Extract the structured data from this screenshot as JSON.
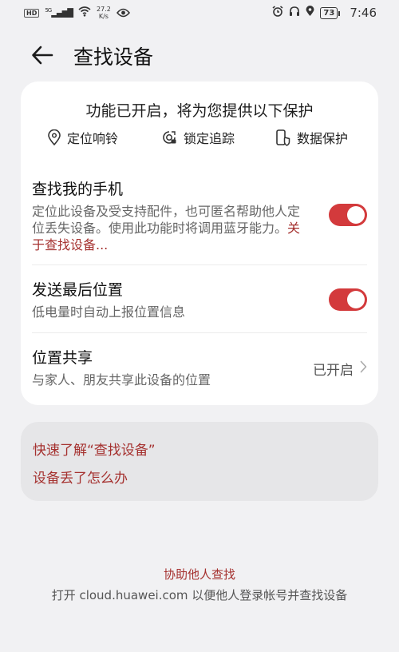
{
  "status_bar": {
    "network_badge": "HD",
    "signal": "5G",
    "speed_value": "27.2",
    "speed_unit": "K/s",
    "battery": "73",
    "time": "7:46",
    "icons": [
      "hd-icon",
      "signal-icon",
      "wifi-icon",
      "eye-icon",
      "alarm-icon",
      "headphones-icon",
      "location-icon",
      "battery-icon"
    ]
  },
  "header": {
    "back_icon": "arrow-left-icon",
    "title": "查找设备"
  },
  "banner": {
    "title": "功能已开启，将为您提供以下保护",
    "features": [
      {
        "icon": "location-pin-icon",
        "label": "定位响铃"
      },
      {
        "icon": "lock-track-icon",
        "label": "锁定追踪"
      },
      {
        "icon": "phone-shield-icon",
        "label": "数据保护"
      }
    ]
  },
  "settings": {
    "find_phone": {
      "title": "查找我的手机",
      "desc": "定位此设备及受支持配件，也可匿名帮助他人定位丢失设备。使用此功能时将调用蓝牙能力。",
      "link": "关于查找设备...",
      "enabled": true
    },
    "last_location": {
      "title": "发送最后位置",
      "desc": "低电量时自动上报位置信息",
      "enabled": true
    },
    "location_share": {
      "title": "位置共享",
      "desc": "与家人、朋友共享此设备的位置",
      "status": "已开启"
    }
  },
  "help": {
    "learn_link": "快速了解“查找设备”",
    "lost_link": "设备丢了怎么办"
  },
  "footer": {
    "help_others_link": "协助他人查找",
    "note": "打开 cloud.huawei.com 以便他人登录帐号并查找设备"
  },
  "colors": {
    "accent": "#a5312f",
    "toggle_on": "#d33a3c",
    "background": "#f1f1f3",
    "card": "#ffffff"
  }
}
